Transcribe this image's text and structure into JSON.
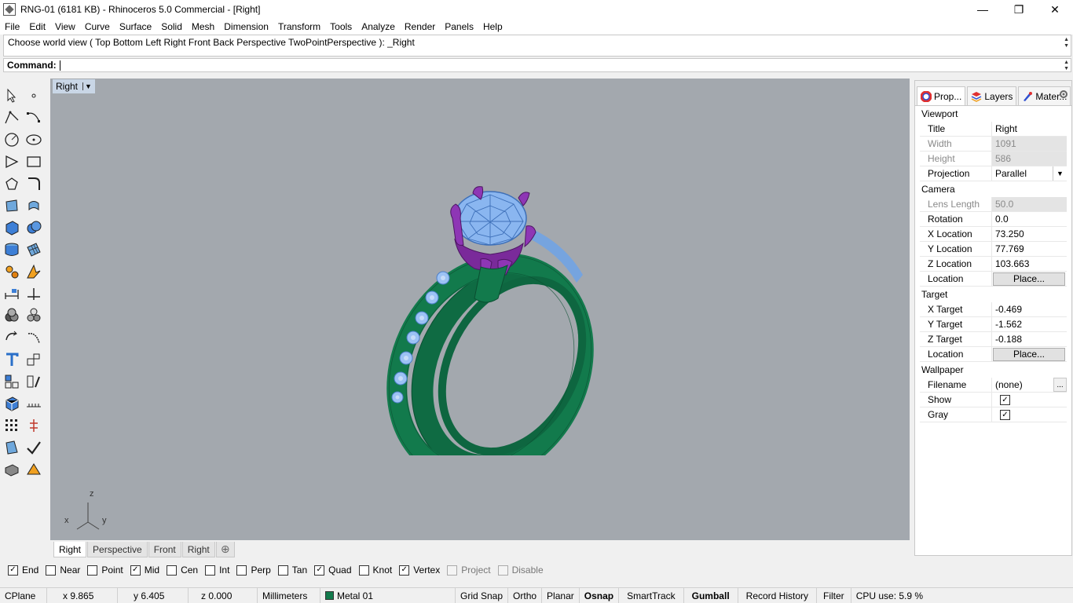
{
  "window": {
    "title": "RNG-01 (6181 KB) - Rhinoceros 5.0 Commercial - [Right]",
    "minimize": "—",
    "maximize": "❐",
    "close": "✕"
  },
  "menu": [
    "File",
    "Edit",
    "View",
    "Curve",
    "Surface",
    "Solid",
    "Mesh",
    "Dimension",
    "Transform",
    "Tools",
    "Analyze",
    "Render",
    "Panels",
    "Help"
  ],
  "command": {
    "history": "Choose world view ( Top  Bottom  Left  Right  Front  Back  Perspective  TwoPointPerspective ): _Right",
    "label": "Command:",
    "value": ""
  },
  "viewport": {
    "title": "Right",
    "dropdown": "▼",
    "axis_labels": {
      "z": "z",
      "x": "x",
      "y": "y"
    }
  },
  "viewport_tabs": [
    "Right",
    "Perspective",
    "Front",
    "Right"
  ],
  "viewport_tab_add": "⊕",
  "osnap": [
    {
      "label": "End",
      "checked": true
    },
    {
      "label": "Near",
      "checked": false
    },
    {
      "label": "Point",
      "checked": false
    },
    {
      "label": "Mid",
      "checked": true
    },
    {
      "label": "Cen",
      "checked": false
    },
    {
      "label": "Int",
      "checked": false
    },
    {
      "label": "Perp",
      "checked": false
    },
    {
      "label": "Tan",
      "checked": false
    },
    {
      "label": "Quad",
      "checked": true
    },
    {
      "label": "Knot",
      "checked": false
    },
    {
      "label": "Vertex",
      "checked": true
    },
    {
      "label": "Project",
      "checked": false,
      "disabled": true
    },
    {
      "label": "Disable",
      "checked": false,
      "disabled": true
    }
  ],
  "status": {
    "cplane": "CPlane",
    "x": "x 9.865",
    "y": "y 6.405",
    "z": "z 0.000",
    "units": "Millimeters",
    "layer": "Metal 01",
    "layer_color": "#127a4c",
    "buttons": [
      {
        "label": "Grid Snap",
        "active": false
      },
      {
        "label": "Ortho",
        "active": false
      },
      {
        "label": "Planar",
        "active": false
      },
      {
        "label": "Osnap",
        "active": true
      },
      {
        "label": "SmartTrack",
        "active": false
      },
      {
        "label": "Gumball",
        "active": true
      },
      {
        "label": "Record History",
        "active": false
      },
      {
        "label": "Filter",
        "active": false
      }
    ],
    "cpu": "CPU use: 5.9 %"
  },
  "panel": {
    "tabs": [
      "Prop...",
      "Layers",
      "Mater..."
    ],
    "sections": {
      "viewport": "Viewport",
      "camera": "Camera",
      "target": "Target",
      "wallpaper": "Wallpaper"
    },
    "viewport_rows": {
      "title": {
        "k": "Title",
        "v": "Right"
      },
      "width": {
        "k": "Width",
        "v": "1091"
      },
      "height": {
        "k": "Height",
        "v": "586"
      },
      "projection": {
        "k": "Projection",
        "v": "Parallel"
      }
    },
    "camera_rows": {
      "lens": {
        "k": "Lens Length",
        "v": "50.0"
      },
      "rotation": {
        "k": "Rotation",
        "v": "0.0"
      },
      "x": {
        "k": "X Location",
        "v": "73.250"
      },
      "y": {
        "k": "Y Location",
        "v": "77.769"
      },
      "z": {
        "k": "Z Location",
        "v": "103.663"
      },
      "loc": {
        "k": "Location",
        "v": "Place..."
      }
    },
    "target_rows": {
      "x": {
        "k": "X Target",
        "v": "-0.469"
      },
      "y": {
        "k": "Y Target",
        "v": "-1.562"
      },
      "z": {
        "k": "Z Target",
        "v": "-0.188"
      },
      "loc": {
        "k": "Location",
        "v": "Place..."
      }
    },
    "wallpaper_rows": {
      "filename": {
        "k": "Filename",
        "v": "(none)"
      },
      "filename_btn": "...",
      "show": {
        "k": "Show",
        "checked": true
      },
      "gray": {
        "k": "Gray",
        "checked": true
      }
    }
  },
  "colors": {
    "viewport_bg": "#a3a8ae",
    "ring_green": "#127a4c",
    "stone_blue": "#8ab6f0",
    "prong_purple": "#7a2a9a"
  }
}
